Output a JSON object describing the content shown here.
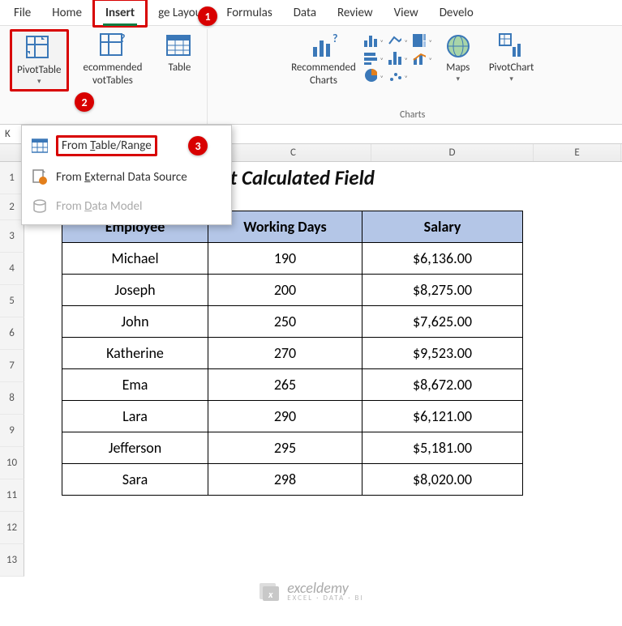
{
  "tabs": {
    "file": "File",
    "home": "Home",
    "insert": "Insert",
    "pagelayout": "ge Layout",
    "formulas": "Formulas",
    "data": "Data",
    "review": "Review",
    "view": "View",
    "developer": "Develo"
  },
  "ribbon": {
    "pivottable": "PivotTable",
    "recommended_pt": "ecommended\nvotTables",
    "table": "Table",
    "rec_charts": "Recommended\nCharts",
    "maps": "Maps",
    "pivotchart": "PivotChart",
    "group_tables": "",
    "group_charts": "Charts"
  },
  "dropdown": {
    "from_table_range": "From Table/Range",
    "from_external": "From External Data Source",
    "from_datamodel": "From Data Model"
  },
  "callouts": {
    "c1": "1",
    "c2": "2",
    "c3": "3"
  },
  "namebox": "K",
  "columns": [
    "C",
    "D",
    "E"
  ],
  "rows": [
    "1",
    "2",
    "3",
    "4",
    "5",
    "6",
    "7",
    "8",
    "9",
    "10",
    "11",
    "12",
    "13"
  ],
  "sheet_title": "Implicit Calculated Field",
  "table": {
    "headers": {
      "employee": "Employee",
      "working_days": "Working Days",
      "salary": "Salary"
    },
    "rows": [
      {
        "employee": "Michael",
        "working_days": "190",
        "salary": "$6,136.00"
      },
      {
        "employee": "Joseph",
        "working_days": "200",
        "salary": "$8,275.00"
      },
      {
        "employee": "John",
        "working_days": "250",
        "salary": "$7,625.00"
      },
      {
        "employee": "Katherine",
        "working_days": "270",
        "salary": "$9,523.00"
      },
      {
        "employee": "Ema",
        "working_days": "265",
        "salary": "$8,672.00"
      },
      {
        "employee": "Lara",
        "working_days": "290",
        "salary": "$6,121.00"
      },
      {
        "employee": "Jefferson",
        "working_days": "295",
        "salary": "$5,181.00"
      },
      {
        "employee": "Sara",
        "working_days": "298",
        "salary": "$8,020.00"
      }
    ]
  },
  "watermark": {
    "name": "exceldemy",
    "sub": "EXCEL · DATA · BI"
  }
}
